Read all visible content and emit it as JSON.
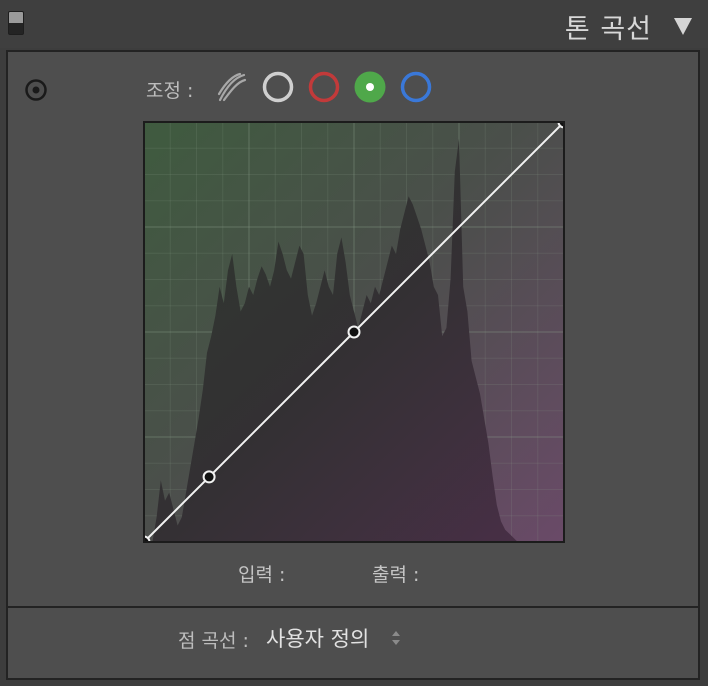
{
  "header": {
    "title": "톤 곡선"
  },
  "controls": {
    "adjust_label": "조정 :",
    "channels": [
      {
        "name": "parametric",
        "color": "#9a9a9a"
      },
      {
        "name": "rgb",
        "color": "#cfcfcf"
      },
      {
        "name": "red",
        "color": "#c23a3a"
      },
      {
        "name": "green",
        "color": "#4fa84a",
        "selected": true
      },
      {
        "name": "blue",
        "color": "#3a78d8"
      }
    ]
  },
  "curve": {
    "input_label": "입력 :",
    "input_value": "",
    "output_label": "출력 :",
    "output_value": "",
    "points": [
      [
        0,
        0
      ],
      [
        0.155,
        0.155
      ],
      [
        0.5,
        0.5
      ],
      [
        1,
        1
      ]
    ],
    "histogram": [
      0,
      0,
      0,
      0.06,
      0.15,
      0.1,
      0.12,
      0.08,
      0.04,
      0.06,
      0.12,
      0.18,
      0.24,
      0.3,
      0.37,
      0.46,
      0.5,
      0.55,
      0.62,
      0.58,
      0.66,
      0.7,
      0.62,
      0.56,
      0.58,
      0.62,
      0.6,
      0.64,
      0.67,
      0.65,
      0.62,
      0.66,
      0.73,
      0.7,
      0.66,
      0.64,
      0.68,
      0.72,
      0.7,
      0.6,
      0.55,
      0.58,
      0.62,
      0.66,
      0.62,
      0.6,
      0.7,
      0.74,
      0.68,
      0.6,
      0.56,
      0.52,
      0.56,
      0.6,
      0.58,
      0.62,
      0.6,
      0.64,
      0.68,
      0.72,
      0.7,
      0.76,
      0.8,
      0.84,
      0.82,
      0.79,
      0.76,
      0.72,
      0.68,
      0.62,
      0.6,
      0.5,
      0.52,
      0.64,
      0.9,
      0.98,
      0.62,
      0.56,
      0.44,
      0.4,
      0.36,
      0.3,
      0.24,
      0.16,
      0.09,
      0.05,
      0.03,
      0.02,
      0.01,
      0,
      0,
      0,
      0,
      0,
      0,
      0,
      0,
      0,
      0,
      0,
      0
    ]
  },
  "point_curve": {
    "label": "점 곡선 :",
    "value": "사용자 정의"
  }
}
